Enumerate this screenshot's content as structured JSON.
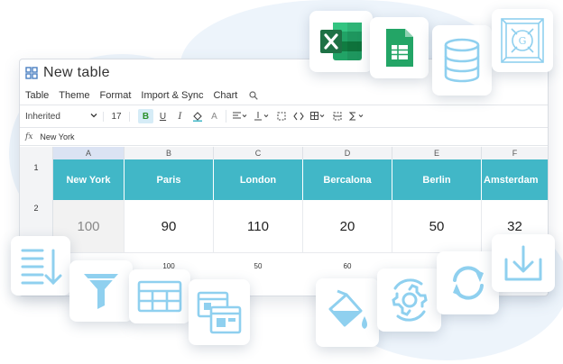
{
  "app": {
    "title": "New table",
    "menu": [
      "Table",
      "Theme",
      "Format",
      "Import & Sync",
      "Chart"
    ]
  },
  "toolbar": {
    "font": "Inherited",
    "font_size": "17",
    "bold": "B",
    "underline": "U",
    "italic": "I",
    "text_color": "A",
    "fx_label": "fx"
  },
  "formula": {
    "value": "New York"
  },
  "grid": {
    "columns": [
      "A",
      "B",
      "C",
      "D",
      "E",
      "F"
    ],
    "rows": [
      "1",
      "2"
    ],
    "header_cells": [
      "New York",
      "Paris",
      "London",
      "Bercalona",
      "Berlin",
      "Amsterdam"
    ],
    "values": [
      "100",
      "90",
      "110",
      "20",
      "50",
      "32"
    ],
    "sub_values": [
      "",
      "100",
      "50",
      "60",
      "",
      ""
    ]
  },
  "colors": {
    "accent": "#41b7c7",
    "icon_blue": "#8fd0ef",
    "excel_green": "#1e7145",
    "sheets_green": "#23a566"
  }
}
